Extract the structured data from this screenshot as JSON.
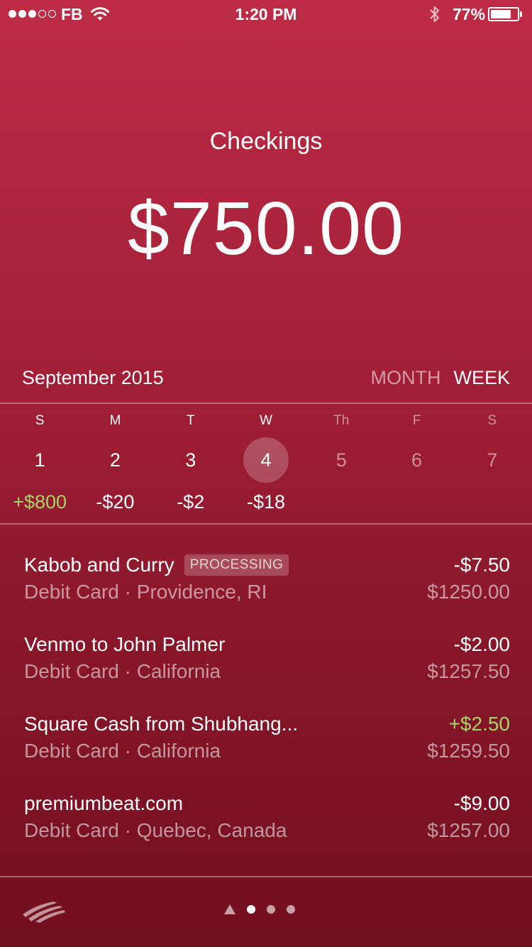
{
  "status_bar": {
    "carrier": "FB",
    "time": "1:20 PM",
    "battery": "77%",
    "battery_level": 0.77,
    "signal_bars_filled": 3,
    "signal_bars_total": 5
  },
  "account": {
    "title": "Checkings",
    "balance": "$750.00"
  },
  "calendar": {
    "month": "September 2015",
    "range_options": [
      "MONTH",
      "WEEK"
    ],
    "selected_range": "WEEK",
    "days": [
      {
        "letter": "S",
        "number": "1",
        "amount": "+$800",
        "type": "positive"
      },
      {
        "letter": "M",
        "number": "2",
        "amount": "-$20",
        "type": "negative"
      },
      {
        "letter": "T",
        "number": "3",
        "amount": "-$2",
        "type": "negative"
      },
      {
        "letter": "W",
        "number": "4",
        "amount": "-$18",
        "type": "negative",
        "selected": true
      },
      {
        "letter": "Th",
        "number": "5",
        "amount": "",
        "type": "future"
      },
      {
        "letter": "F",
        "number": "6",
        "amount": "",
        "type": "future"
      },
      {
        "letter": "S",
        "number": "7",
        "amount": "",
        "type": "future"
      }
    ]
  },
  "transactions": [
    {
      "name": "Kabob and Curry",
      "badge": "PROCESSING",
      "method": "Debit Card",
      "location": "Providence, RI",
      "amount": "-$7.50",
      "balance": "$1250.00",
      "positive": false
    },
    {
      "name": "Venmo to John Palmer",
      "badge": "",
      "method": "Debit Card",
      "location": "California",
      "amount": "-$2.00",
      "balance": "$1257.50",
      "positive": false
    },
    {
      "name": "Square Cash from Shubhang...",
      "badge": "",
      "method": "Debit Card",
      "location": "California",
      "amount": "+$2.50",
      "balance": "$1259.50",
      "positive": true
    },
    {
      "name": "premiumbeat.com",
      "badge": "",
      "method": "Debit Card",
      "location": "Quebec, Canada",
      "amount": "-$9.00",
      "balance": "$1257.00",
      "positive": false
    }
  ],
  "separator": " · ",
  "pager": {
    "pages": 3,
    "active": 0
  },
  "colors": {
    "background_top": "#bd2c45",
    "background_bottom": "#720f1f",
    "positive": "#a7d36a"
  },
  "icons": {
    "wifi": "wifi-icon",
    "bluetooth": "bluetooth-icon",
    "logo": "bank-logo-icon",
    "pager_first": "triangle-icon"
  }
}
